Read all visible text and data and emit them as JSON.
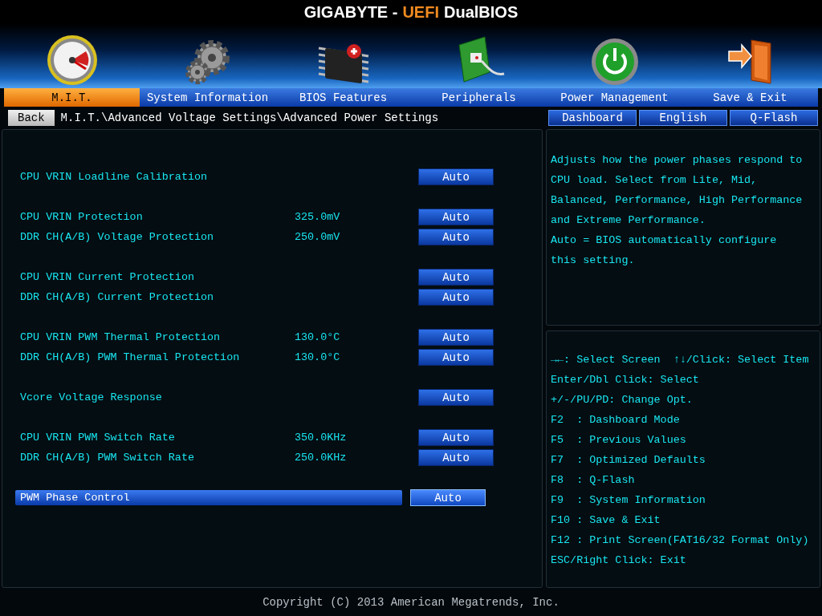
{
  "header": {
    "brand": "GIGABYTE -",
    "accent": "UEFI",
    "product": "DualBIOS"
  },
  "tabs": [
    {
      "label": "M.I.T.",
      "selected": true
    },
    {
      "label": "System Information",
      "selected": false
    },
    {
      "label": "BIOS Features",
      "selected": false
    },
    {
      "label": "Peripherals",
      "selected": false
    },
    {
      "label": "Power Management",
      "selected": false
    },
    {
      "label": "Save & Exit",
      "selected": false
    }
  ],
  "nav": {
    "back": "Back",
    "breadcrumb": "M.I.T.\\Advanced Voltage Settings\\Advanced Power Settings",
    "buttons": [
      "Dashboard",
      "English",
      "Q-Flash"
    ]
  },
  "settings": [
    {
      "items": [
        {
          "label": "CPU VRIN Loadline Calibration",
          "option": "Auto",
          "selected": false
        }
      ]
    },
    {
      "items": [
        {
          "label": "CPU VRIN Protection",
          "value": "325.0mV",
          "option": "Auto",
          "selected": false
        },
        {
          "label": "DDR CH(A/B) Voltage Protection",
          "value": "250.0mV",
          "option": "Auto",
          "selected": false
        }
      ]
    },
    {
      "items": [
        {
          "label": "CPU VRIN Current Protection",
          "option": "Auto",
          "selected": false
        },
        {
          "label": "DDR CH(A/B) Current Protection",
          "option": "Auto",
          "selected": false
        }
      ]
    },
    {
      "items": [
        {
          "label": "CPU VRIN PWM Thermal Protection",
          "value": "130.0°C",
          "option": "Auto",
          "selected": false
        },
        {
          "label": "DDR CH(A/B) PWM Thermal Protection",
          "value": "130.0°C",
          "option": "Auto",
          "selected": false
        }
      ]
    },
    {
      "items": [
        {
          "label": "Vcore Voltage Response",
          "option": "Auto",
          "selected": false
        }
      ]
    },
    {
      "items": [
        {
          "label": "CPU VRIN PWM Switch Rate",
          "value": "350.0KHz",
          "option": "Auto",
          "selected": false
        },
        {
          "label": "DDR CH(A/B) PWM Switch Rate",
          "value": "250.0KHz",
          "option": "Auto",
          "selected": false
        }
      ]
    },
    {
      "items": [
        {
          "label": "PWM Phase Control",
          "option": "Auto",
          "selected": true
        }
      ]
    }
  ],
  "help": [
    "Adjusts how the power phases respond to CPU load. Select from Lite, Mid, Balanced, Performance, High Performance and Extreme Performance.",
    "Auto = BIOS automatically configure this setting."
  ],
  "keys": [
    "→←: Select Screen  ↑↓/Click: Select Item",
    "Enter/Dbl Click: Select",
    "+/-/PU/PD: Change Opt.",
    "F2  : Dashboard Mode",
    "F5  : Previous Values",
    "F7  : Optimized Defaults",
    "F8  : Q-Flash",
    "F9  : System Information",
    "F10 : Save & Exit",
    "F12 : Print Screen(FAT16/32 Format Only)",
    "ESC/Right Click: Exit"
  ],
  "footer": "Copyright (C) 2013 American Megatrends, Inc."
}
